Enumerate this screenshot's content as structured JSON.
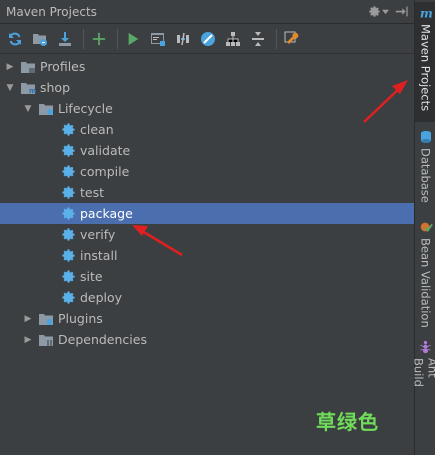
{
  "panel": {
    "title": "Maven Projects"
  },
  "toolbar": {
    "buttons": [
      {
        "name": "reimport",
        "icon": "refresh-icon"
      },
      {
        "name": "generate-sources",
        "icon": "folder-sync-icon"
      },
      {
        "name": "download",
        "icon": "download-icon"
      },
      {
        "name": "add",
        "icon": "plus-icon"
      },
      {
        "name": "run",
        "icon": "run-icon"
      },
      {
        "name": "execute-goal",
        "icon": "terminal-icon"
      },
      {
        "name": "toggle-offline",
        "icon": "offline-icon"
      },
      {
        "name": "skip-tests",
        "icon": "skip-icon"
      },
      {
        "name": "show-dependencies",
        "icon": "diagram-icon"
      },
      {
        "name": "collapse-all",
        "icon": "collapse-icon"
      },
      {
        "name": "settings",
        "icon": "wrench-icon"
      }
    ]
  },
  "tree": {
    "profiles": "Profiles",
    "project": "shop",
    "lifecycle": "Lifecycle",
    "goals": [
      "clean",
      "validate",
      "compile",
      "test",
      "package",
      "verify",
      "install",
      "site",
      "deploy"
    ],
    "selected_goal": "package",
    "plugins": "Plugins",
    "dependencies": "Dependencies"
  },
  "sidebar": {
    "tabs": [
      {
        "label": "Maven Projects",
        "icon": "maven-icon"
      },
      {
        "label": "Database",
        "icon": "database-icon"
      },
      {
        "label": "Bean Validation",
        "icon": "bean-icon"
      },
      {
        "label": "Ant Build",
        "icon": "ant-icon"
      }
    ]
  },
  "watermark": "草绿色",
  "colors": {
    "selection": "#4b6eaf",
    "gear": "#5ab0e8",
    "arrow": "#e02020",
    "watermark": "#6fdc5a"
  }
}
